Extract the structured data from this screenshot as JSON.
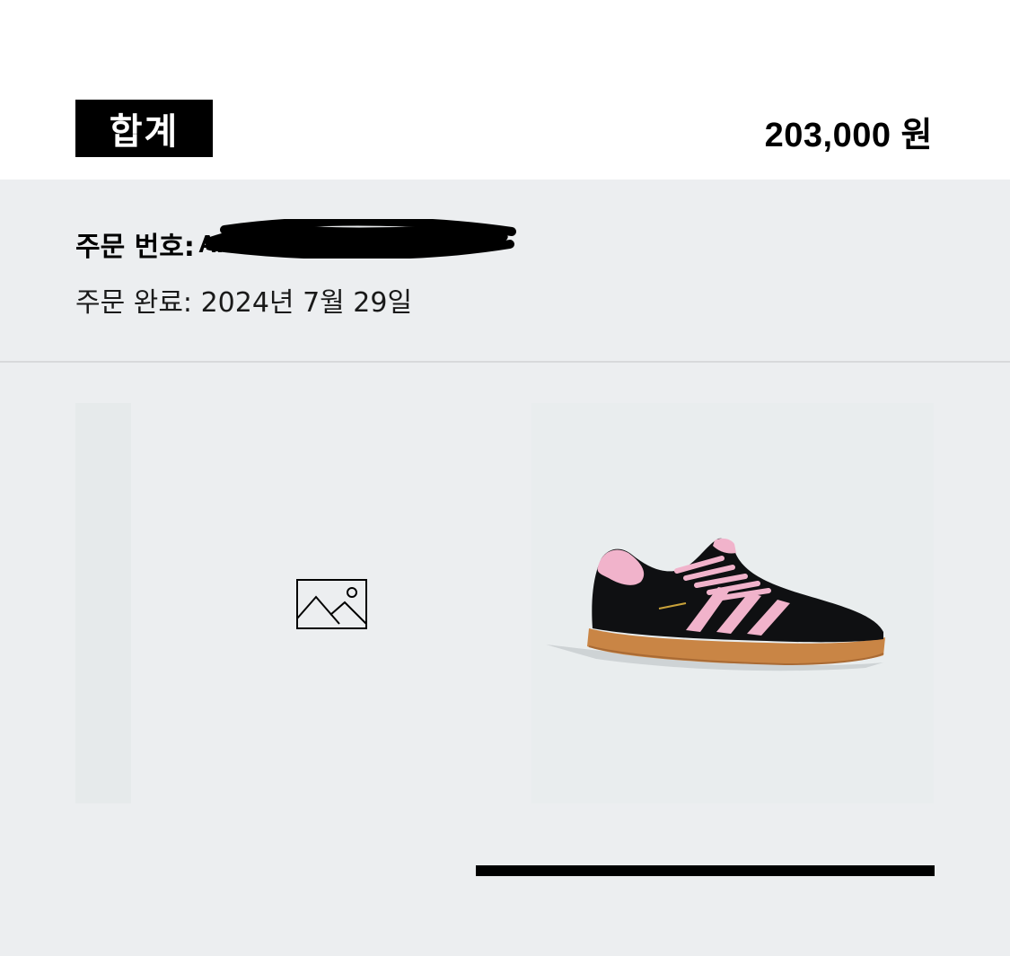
{
  "summary": {
    "total_label": "합계",
    "total_amount": "203,000 원"
  },
  "order": {
    "number_label": "주문 번호:",
    "number_value": "AKR052046",
    "completion_text": "주문 완료: 2024년 7월 29일"
  },
  "product": {
    "placeholder_icon": "image-placeholder-icon",
    "shoe_colors": {
      "upper": "#0f1012",
      "stripes": "#f1b3cb",
      "sole": "#c98545"
    }
  },
  "colors": {
    "accent": "#000000",
    "panel_background": "#eceef0"
  }
}
